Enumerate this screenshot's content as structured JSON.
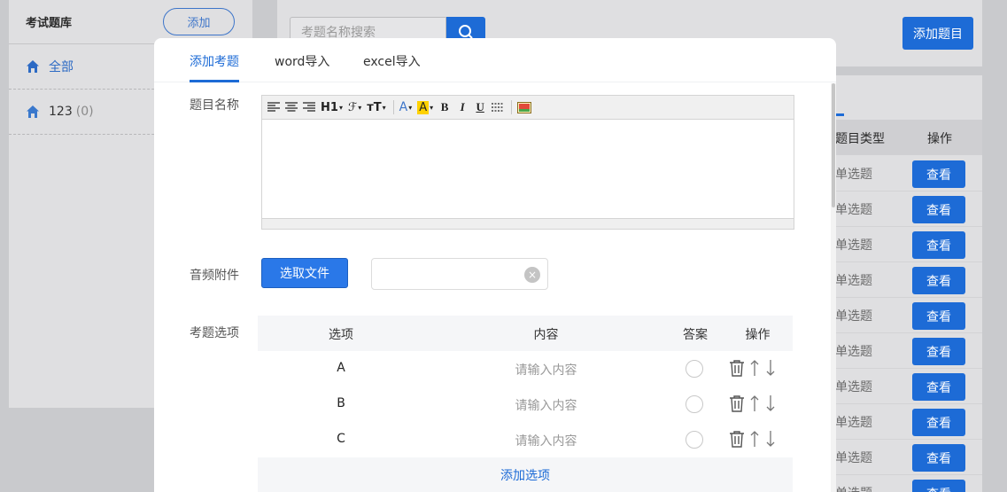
{
  "left_panel": {
    "title": "考试题库",
    "add_label": "添加",
    "items": [
      {
        "label": "全部",
        "count": ""
      },
      {
        "label": "123",
        "count": "(0)"
      }
    ]
  },
  "top_bar": {
    "search_placeholder": "考题名称搜索",
    "add_question_label": "添加题目"
  },
  "background_table": {
    "col_type": "题目类型",
    "col_op": "操作",
    "rows": [
      {
        "type": "单选题",
        "action": "查看"
      },
      {
        "type": "单选题",
        "action": "查看"
      },
      {
        "type": "单选题",
        "action": "查看"
      },
      {
        "type": "单选题",
        "action": "查看"
      },
      {
        "type": "单选题",
        "action": "查看"
      },
      {
        "type": "单选题",
        "action": "查看"
      },
      {
        "type": "单选题",
        "action": "查看"
      },
      {
        "type": "单选题",
        "action": "查看"
      },
      {
        "type": "单选题",
        "action": "查看"
      },
      {
        "type": "单选题",
        "action": "查看"
      }
    ]
  },
  "modal": {
    "tabs": [
      "添加考题",
      "word导入",
      "excel导入"
    ],
    "active_tab": "添加考题",
    "question_name_label": "题目名称",
    "editor_toolbar": {
      "heading": "H1",
      "font": "ℱ",
      "size": "ᴛT",
      "font_color": "A",
      "bg_color": "A",
      "bold": "B",
      "italic": "I",
      "underline": "U",
      "highlight_color": "#ffd100",
      "font_color_value": "#3d75c9"
    },
    "audio_label": "音频附件",
    "choose_file_label": "选取文件",
    "clear_icon": "×",
    "options_label": "考题选项",
    "options_table": {
      "headers": {
        "key": "选项",
        "content": "内容",
        "answer": "答案",
        "op": "操作"
      },
      "rows": [
        {
          "key": "A",
          "placeholder": "请输入内容"
        },
        {
          "key": "B",
          "placeholder": "请输入内容"
        },
        {
          "key": "C",
          "placeholder": "请输入内容"
        }
      ],
      "add_option_label": "添加选项"
    }
  },
  "colors": {
    "primary": "#1d6bd6",
    "overlay": "#c9cacd"
  }
}
